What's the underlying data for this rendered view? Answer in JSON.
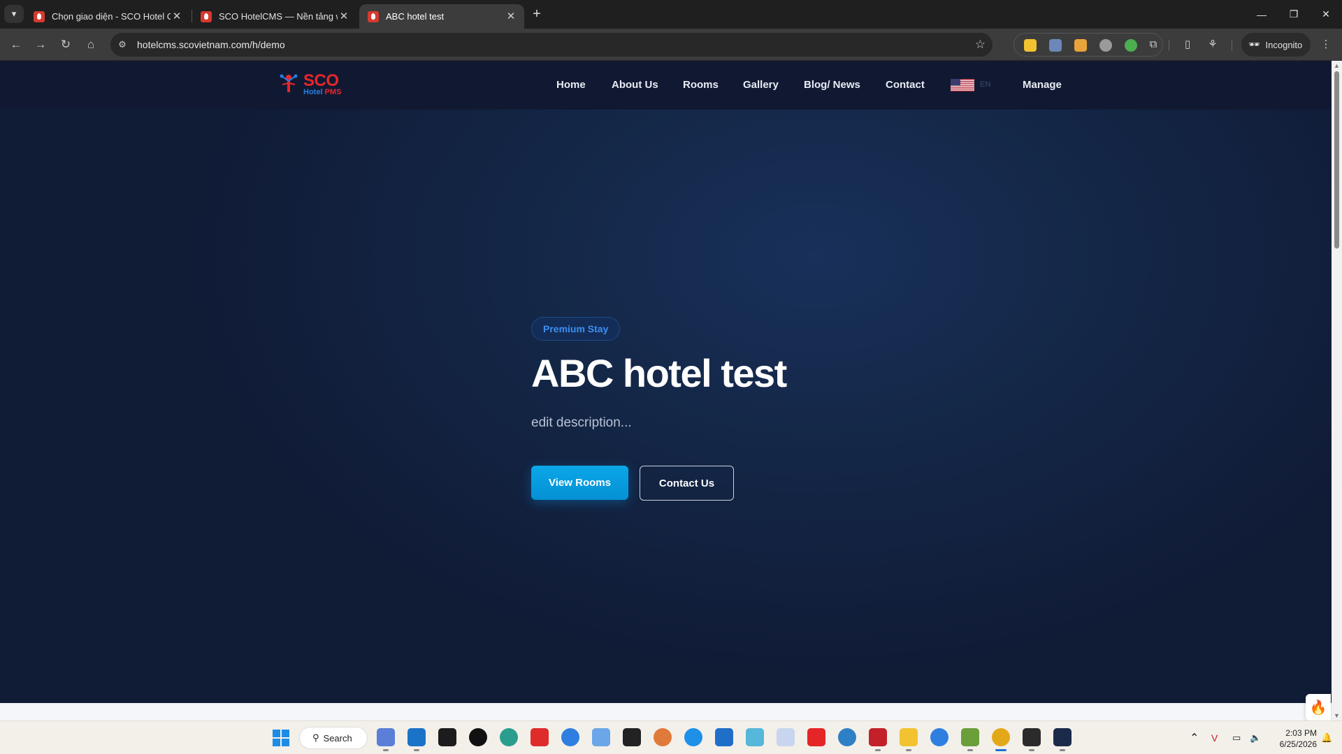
{
  "browser": {
    "tabs": [
      {
        "title": "Chọn giao diện - SCO Hotel CMS",
        "active": false
      },
      {
        "title": "SCO HotelCMS — Nền tảng website",
        "active": false
      },
      {
        "title": "ABC hotel test",
        "active": true
      }
    ],
    "new_tab_symbol": "+",
    "url": "hotelcms.scovietnam.com/h/demo",
    "incognito_label": "Incognito"
  },
  "site": {
    "logo": {
      "brand": "SCO",
      "sub_hotel": "Hotel",
      "sub_pms": "PMS"
    },
    "nav": [
      "Home",
      "About Us",
      "Rooms",
      "Gallery",
      "Blog/ News",
      "Contact"
    ],
    "lang_code": "EN",
    "manage_label": "Manage"
  },
  "hero": {
    "badge": "Premium Stay",
    "title": "ABC hotel test",
    "description": "edit description...",
    "primary_button": "View Rooms",
    "secondary_button": "Contact Us"
  },
  "taskbar": {
    "search_label": "Search",
    "time": "2:03 PM",
    "date": "6/25/2026"
  },
  "colors": {
    "accent": "#0aa7e8",
    "brand_red": "#e8262b",
    "hero_bg": "#142747"
  }
}
